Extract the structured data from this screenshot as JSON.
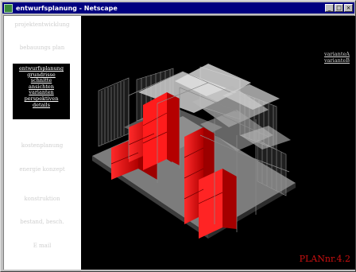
{
  "window": {
    "title": "entwurfsplanung - Netscape"
  },
  "left_nav": {
    "top_links": [
      "projektentwicklung",
      "bebauungs plan"
    ],
    "submenu": [
      "entwurfsplanung",
      "grundrisse",
      "schnitte",
      "ansichten",
      "varianten",
      "perspektiven",
      "details"
    ],
    "bottom_links": [
      "kostenplanung",
      "energie konzept",
      "konstruktion",
      "bestand, besch.",
      "E mail"
    ]
  },
  "viewer": {
    "variant_links": [
      "varianteA",
      "varianteB"
    ],
    "plan_label": "PLANnr.4.2",
    "colors": {
      "accent_red": "#e01010",
      "background": "#000000"
    }
  }
}
